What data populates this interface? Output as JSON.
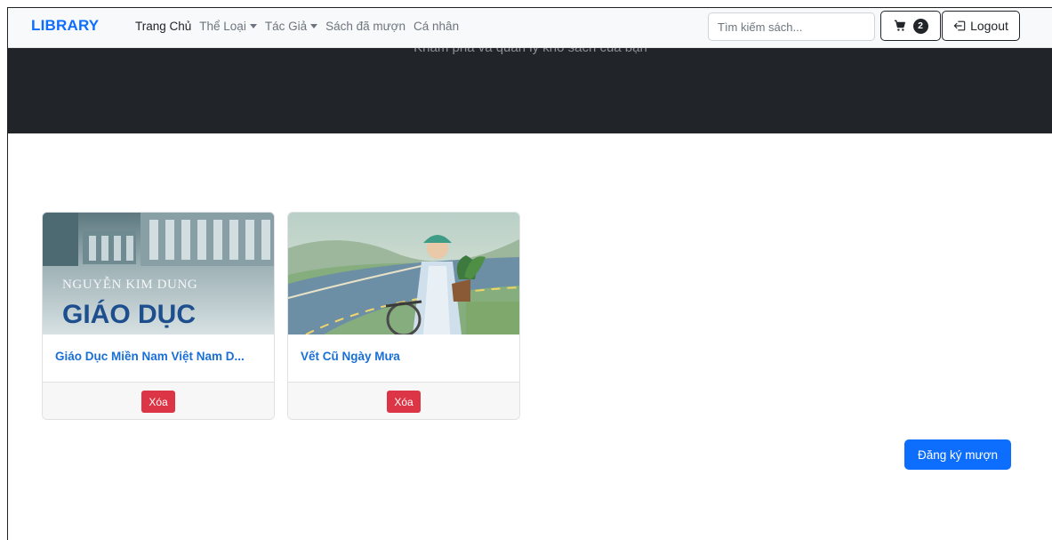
{
  "navbar": {
    "brand": "LIBRARY",
    "links": [
      {
        "label": "Trang Chủ"
      },
      {
        "label": "Thể Loại"
      },
      {
        "label": "Tác Giả"
      },
      {
        "label": "Sách đã mượn"
      },
      {
        "label": "Cá nhân"
      }
    ],
    "search_placeholder": "Tìm kiếm sách...",
    "cart_count": "2",
    "logout_label": "Logout"
  },
  "hero": {
    "subtitle": "Khám phá và quản lý kho sách của bạn"
  },
  "books": [
    {
      "title": "Giáo Dục Miền Nam Việt Nam D...",
      "cover_author": "NGUYỄN KIM DUNG",
      "cover_title": "GIÁO DỤC",
      "delete_label": "Xóa"
    },
    {
      "title": "Vết Cũ Ngày Mưa",
      "delete_label": "Xóa"
    }
  ],
  "actions": {
    "borrow_label": "Đăng ký mượn"
  },
  "colors": {
    "primary": "#0d6efd",
    "danger": "#dc3545",
    "dark": "#212529"
  }
}
